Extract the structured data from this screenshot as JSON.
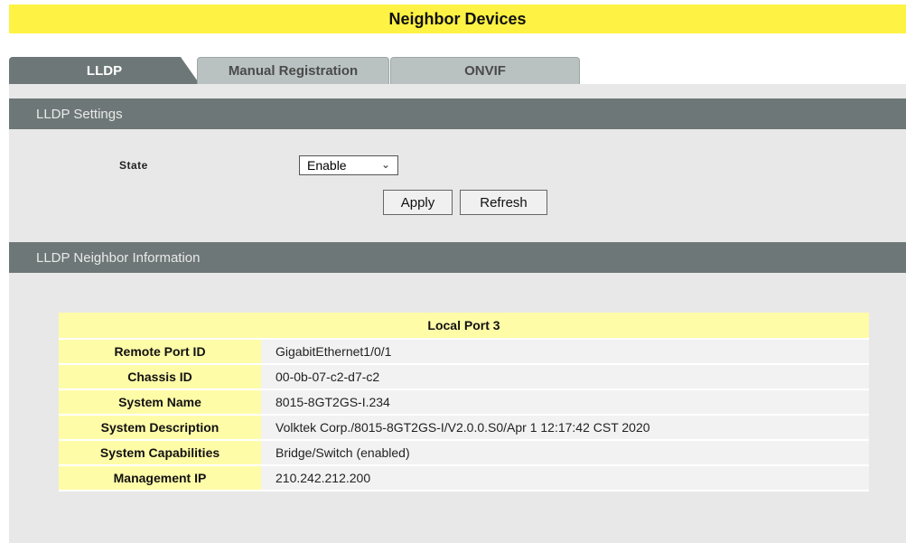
{
  "page": {
    "title": "Neighbor Devices"
  },
  "tabs": [
    {
      "label": "LLDP",
      "active": true
    },
    {
      "label": "Manual Registration",
      "active": false
    },
    {
      "label": "ONVIF",
      "active": false
    }
  ],
  "lldp_settings": {
    "title": "LLDP Settings",
    "state_label": "State",
    "state_value": "Enable",
    "apply_label": "Apply",
    "refresh_label": "Refresh"
  },
  "neighbor_info": {
    "title": "LLDP Neighbor Information",
    "table_header": "Local Port 3",
    "rows": [
      {
        "key": "Remote Port ID",
        "value": "GigabitEthernet1/0/1"
      },
      {
        "key": "Chassis ID",
        "value": "00-0b-07-c2-d7-c2"
      },
      {
        "key": "System Name",
        "value": "8015-8GT2GS-I.234"
      },
      {
        "key": "System Description",
        "value": "Volktek Corp./8015-8GT2GS-I/V2.0.0.S0/Apr 1 12:17:42 CST 2020"
      },
      {
        "key": "System Capabilities",
        "value": "Bridge/Switch (enabled)"
      },
      {
        "key": "Management IP",
        "value": "210.242.212.200"
      }
    ]
  },
  "colors": {
    "title_bar": "#fef244",
    "section_bar": "#6e7777",
    "key_cell": "#fffca8",
    "panel": "#e8e8e8"
  }
}
